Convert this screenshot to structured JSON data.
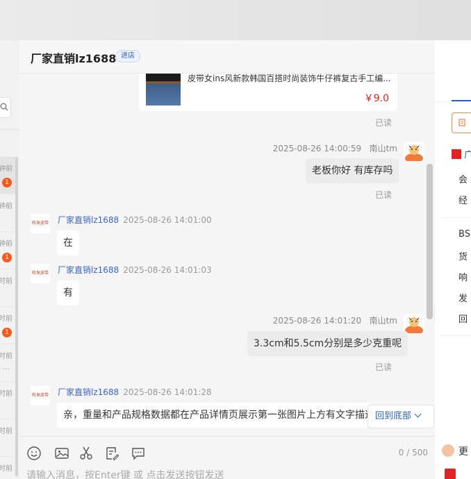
{
  "header": {
    "title": "厂家直销lz1688",
    "enter_shop": "进店"
  },
  "left_list": {
    "items": [
      {
        "time": "钟前",
        "badge": "1",
        "active": true
      },
      {
        "time": "钟前",
        "badge": "",
        "active": false
      },
      {
        "time": "钟前",
        "badge": "1",
        "active": false
      },
      {
        "time": "时前",
        "badge": "",
        "active": false
      },
      {
        "time": "时前",
        "badge": "1",
        "active": false
      },
      {
        "time": "时前",
        "badge": "",
        "dots": "…",
        "active": false
      },
      {
        "time": "时前",
        "badge": "",
        "active": false
      },
      {
        "time": "时前",
        "badge": "",
        "active": false
      },
      {
        "time": "时前",
        "badge": "",
        "active": false
      }
    ]
  },
  "product": {
    "title": "皮带女ins风新款韩国百搭时尚装饰牛仔裤复古手工编...",
    "price": "￥9.0"
  },
  "messages": {
    "read_label": "已读",
    "shop_avatar_text": "旺发皮带",
    "m1": {
      "sender": "南山tm",
      "time": "2025-08-26 14:00:59",
      "text": "老板你好 有库存吗"
    },
    "m2": {
      "sender": "厂家直销lz1688",
      "time": "2025-08-26 14:01:00",
      "text": "在"
    },
    "m3": {
      "sender": "厂家直销lz1688",
      "time": "2025-08-26 14:01:03",
      "text": "有"
    },
    "m4": {
      "sender": "南山tm",
      "time": "2025-08-26 14:01:20",
      "text": "3.3cm和5.5cm分别是多少克重呢"
    },
    "m5": {
      "sender": "厂家直销lz1688",
      "time": "2025-08-26 14:01:28",
      "text": "亲，重量和产品规格数据都在产品详情页展示第一张图片上方有文字描述"
    }
  },
  "back_to_bottom": "回到底部",
  "expand_glyph": "»",
  "composer": {
    "counter": "0 / 500",
    "placeholder": "请输入消息，按Enter键 或 点击发送按钮发送"
  },
  "right_panel": {
    "shop_name": "广",
    "rows": [
      "会",
      "经",
      "BS",
      "货",
      "响",
      "发",
      "回"
    ],
    "bottom_label": "更"
  },
  "colors": {
    "accent": "#2c5ec2",
    "badge": "#f5591c",
    "price": "#e02020"
  }
}
